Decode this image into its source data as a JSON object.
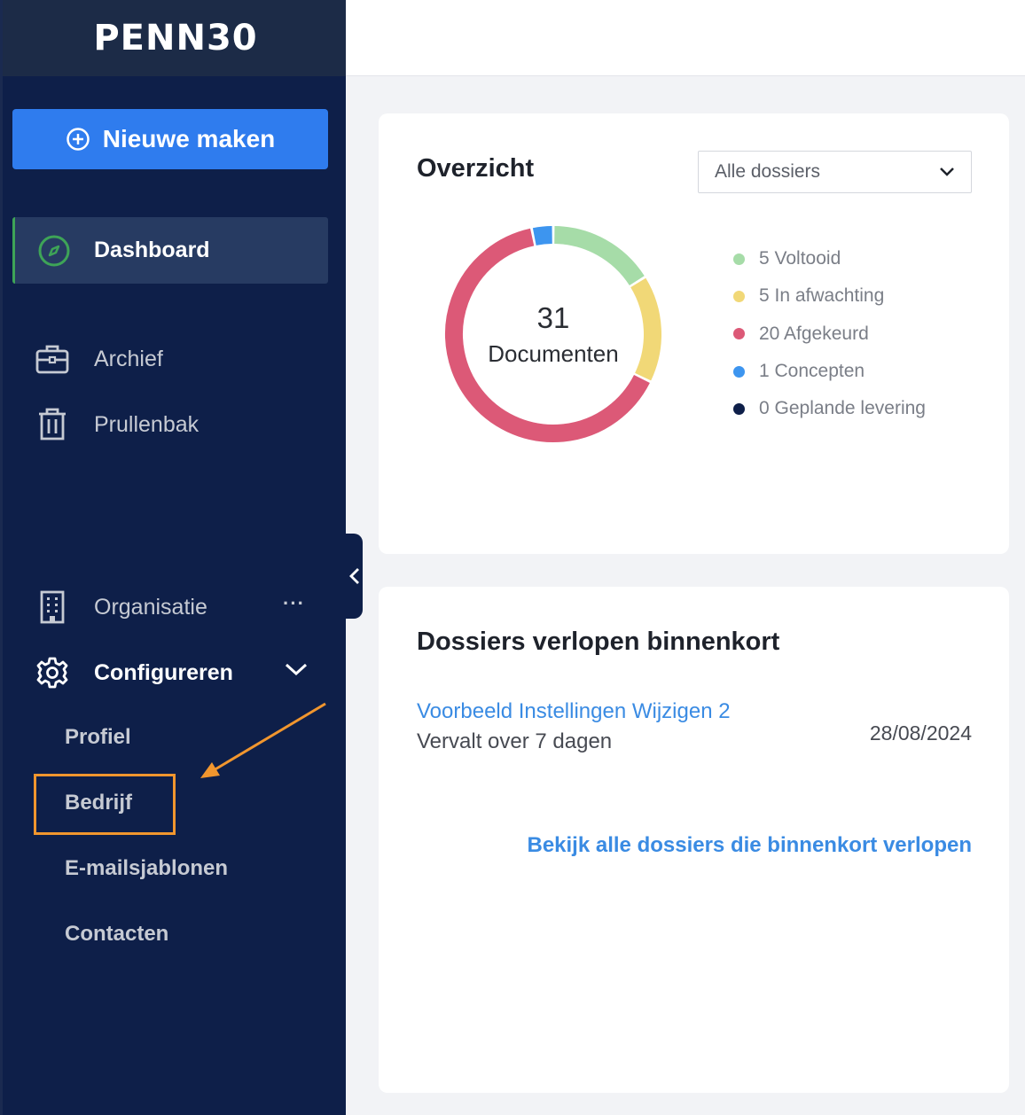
{
  "app": {
    "logo": "PENN30"
  },
  "sidebar": {
    "new_button": "Nieuwe maken",
    "dashboard": "Dashboard",
    "items": [
      {
        "label": "Archief",
        "icon": "briefcase-icon"
      },
      {
        "label": "Prullenbak",
        "icon": "trash-icon"
      }
    ],
    "organisation": {
      "label": "Organisatie",
      "more": "···"
    },
    "configure": {
      "label": "Configureren"
    },
    "sub_items": [
      "Profiel",
      "Bedrijf",
      "E-mailsjablonen",
      "Contacten"
    ]
  },
  "overview": {
    "title": "Overzicht",
    "filter": "Alle dossiers",
    "total": "31",
    "total_label": "Documenten",
    "legend": [
      {
        "label": "5 Voltooid",
        "value": 5,
        "color": "#a6dca8"
      },
      {
        "label": "5 In afwachting",
        "value": 5,
        "color": "#f1d877"
      },
      {
        "label": "20 Afgekeurd",
        "value": 20,
        "color": "#dc5977"
      },
      {
        "label": "1 Concepten",
        "value": 1,
        "color": "#3d95ef"
      },
      {
        "label": "0 Geplande levering",
        "value": 0,
        "color": "#0e1f49"
      }
    ]
  },
  "expiring": {
    "title": "Dossiers verlopen binnenkort",
    "item_name": "Voorbeeld Instellingen Wijzigen 2",
    "item_sub": "Vervalt over 7 dagen",
    "item_date": "28/08/2024",
    "view_all": "Bekijk alle dossiers die binnenkort verlopen"
  },
  "colors": {
    "sidebar": "#0e1f49",
    "accent": "#2f7cee",
    "link": "#3a8be3",
    "highlight": "#f1962e"
  }
}
